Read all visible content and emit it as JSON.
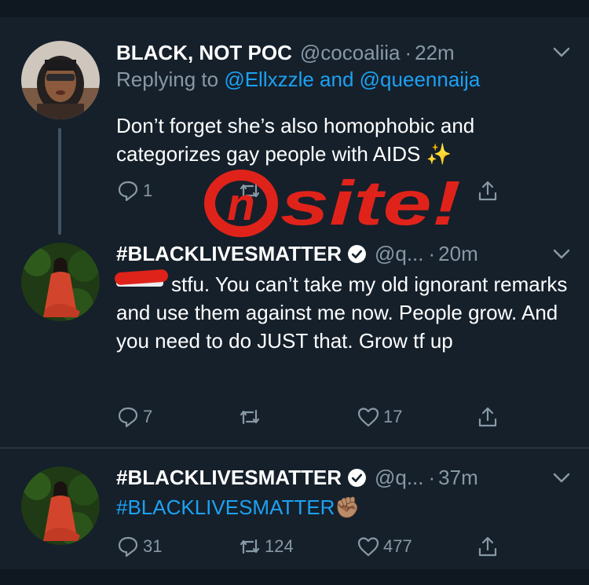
{
  "tweets": [
    {
      "display_name": "BLACK, NOT POC",
      "handle": "@cocoaliia",
      "separator": "·",
      "time": "22m",
      "replying_prefix": "Replying to ",
      "replying_to": "@Ellxzzle and @queennaija",
      "text": "Don’t forget she’s also homophobic and categorizes gay people with AIDS",
      "emoji": "✨",
      "replies": "1",
      "retweets": "",
      "likes": ""
    },
    {
      "display_name": "#BLACKLIVESMATTER",
      "handle": "@q...",
      "separator": "·",
      "time": "20m",
      "verified": true,
      "text": "stfu. You can’t take my old ignorant remarks and use them against me now. People grow. And you need to do JUST that. Grow tf up",
      "replies": "7",
      "retweets": "",
      "likes": "17"
    },
    {
      "display_name": "#BLACKLIVESMATTER",
      "handle": "@q...",
      "separator": "·",
      "time": "37m",
      "verified": true,
      "text": "#BLACKLIVESMATTER",
      "emoji": "✊🏽",
      "replies": "31",
      "retweets": "124",
      "likes": "477"
    }
  ],
  "watermark": {
    "text": "Onsite!",
    "color": "#e0231a"
  },
  "icons": [
    "reply-icon",
    "retweet-icon",
    "like-icon",
    "share-icon",
    "verified-badge-icon",
    "chevron-down-icon"
  ],
  "colors": {
    "background": "#15202b",
    "link": "#1da1f2",
    "muted": "#8899a6",
    "divider": "#38444d"
  }
}
